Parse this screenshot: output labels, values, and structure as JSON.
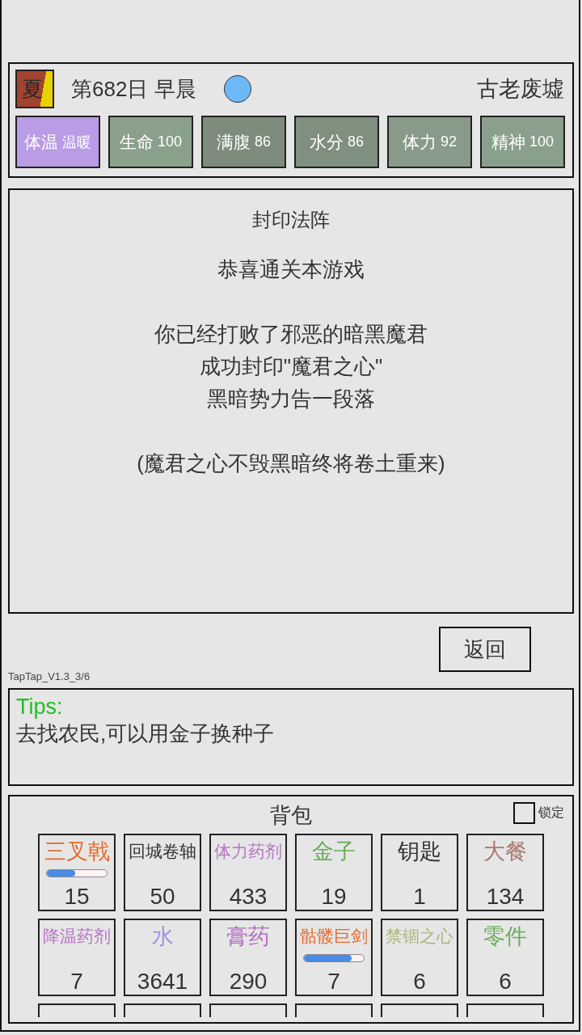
{
  "status": {
    "season": "夏",
    "date_time": "第682日 早晨",
    "location": "古老废墟",
    "stats": [
      {
        "label": "体温",
        "value": "温暖",
        "color": "#b99be6"
      },
      {
        "label": "生命",
        "value": "100",
        "color": "#8ba08b"
      },
      {
        "label": "满腹",
        "value": "86",
        "color": "#7d8c7d"
      },
      {
        "label": "水分",
        "value": "86",
        "color": "#7f8f80"
      },
      {
        "label": "体力",
        "value": "92",
        "color": "#889a89"
      },
      {
        "label": "精神",
        "value": "100",
        "color": "#8a9f8c"
      }
    ]
  },
  "message": {
    "title": "封印法阵",
    "paragraphs": [
      [
        "恭喜通关本游戏"
      ],
      [
        "你已经打败了邪恶的暗黑魔君",
        "成功封印\"魔君之心\"",
        "黑暗势力告一段落"
      ],
      [
        "(魔君之心不毁黑暗终将卷土重来)"
      ]
    ]
  },
  "back_button": "返回",
  "version": "TapTap_V1.3_3/6",
  "tips": {
    "heading": "Tips:",
    "text": "去找农民,可以用金子换种子"
  },
  "backpack": {
    "title": "背包",
    "lock": {
      "label": "锁定",
      "checked": false
    },
    "items": [
      {
        "name": "三叉戟",
        "color": "#e46b2a",
        "count": "15",
        "level": 0.47
      },
      {
        "name": "回城卷轴",
        "color": "#333333",
        "count": "50"
      },
      {
        "name": "体力药剂",
        "color": "#b474c4",
        "count": "433"
      },
      {
        "name": "金子",
        "color": "#6aab5a",
        "count": "19"
      },
      {
        "name": "钥匙",
        "color": "#333333",
        "count": "1"
      },
      {
        "name": "大餐",
        "color": "#a87870",
        "count": "134"
      },
      {
        "name": "降温药剂",
        "color": "#b674c6",
        "count": "7"
      },
      {
        "name": "水",
        "color": "#9a96e0",
        "count": "3641"
      },
      {
        "name": "膏药",
        "color": "#b070c0",
        "count": "290"
      },
      {
        "name": "骷髅巨剑",
        "color": "#e46b2a",
        "count": "7",
        "level": 0.8
      },
      {
        "name": "禁锢之心",
        "color": "#b0b57a",
        "count": "6"
      },
      {
        "name": "零件",
        "color": "#6aab5a",
        "count": "6"
      }
    ]
  }
}
